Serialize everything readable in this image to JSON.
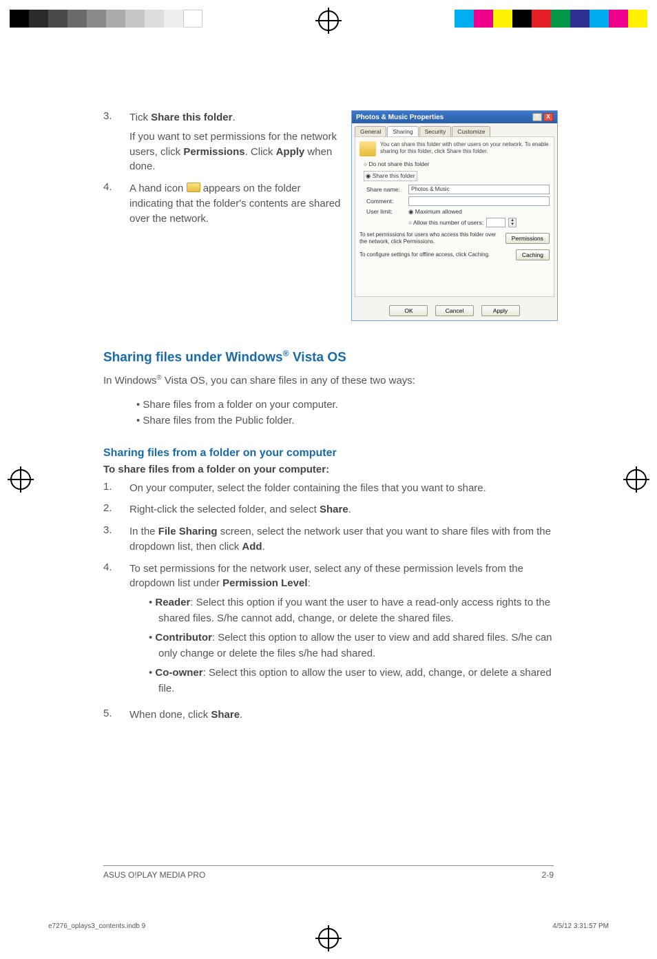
{
  "steps_top": {
    "s3": {
      "num": "3.",
      "line1_pre": "Tick ",
      "line1_bold": "Share this folder",
      "line1_post": ".",
      "line2_pre": "If you want to set permissions for the network users, click ",
      "line2_bold": "Permissions",
      "line2_mid": ". Click ",
      "line2_bold2": "Apply",
      "line2_post": " when done."
    },
    "s4": {
      "num": "4.",
      "pre": "A hand icon ",
      "post": " appears on the folder indicating that the folder's contents are shared over the network."
    }
  },
  "dialog": {
    "title": "Photos & Music Properties",
    "tabs": {
      "general": "General",
      "sharing": "Sharing",
      "security": "Security",
      "customize": "Customize"
    },
    "info": "You can share this folder with other users on your network.   To enable sharing for this folder, click Share this folder.",
    "opt_no_share": "Do not share this folder",
    "opt_share": "Share this folder",
    "share_name_label": "Share name:",
    "share_name_value": "Photos & Music",
    "comment_label": "Comment:",
    "userlimit_label": "User limit:",
    "opt_max": "Maximum allowed",
    "opt_allow": "Allow this number of users:",
    "perm_text": "To set permissions for users who access this folder over the network, click Permissions.",
    "perm_btn": "Permissions",
    "cache_text": "To configure settings for offline access, click Caching.",
    "cache_btn": "Caching",
    "ok": "OK",
    "cancel": "Cancel",
    "apply": "Apply",
    "help": "?",
    "close": "X"
  },
  "vista": {
    "heading_pre": "Sharing files under Windows",
    "heading_post": " Vista OS",
    "intro_pre": "In Windows",
    "intro_post": " Vista OS, you can share files in any of these two ways:",
    "bul1": "Share files from a folder on your computer.",
    "bul2": "Share files from the Public folder."
  },
  "folder": {
    "heading": "Sharing files from a folder on your computer",
    "lead": "To share files from a folder on your computer:",
    "s1": {
      "num": "1.",
      "text": "On your computer, select the folder containing the files that you want to share."
    },
    "s2": {
      "num": "2.",
      "pre": "Right-click the selected folder, and select ",
      "bold": "Share",
      "post": "."
    },
    "s3": {
      "num": "3.",
      "pre": "In the ",
      "bold1": "File Sharing",
      "mid": " screen, select the network user that you want to share files with from the dropdown list, then click ",
      "bold2": "Add",
      "post": "."
    },
    "s4": {
      "num": "4.",
      "pre": "To set permissions for the network user, select any of these permission levels from the dropdown list under ",
      "bold": "Permission Level",
      "post": ":",
      "reader_label": "Reader",
      "reader_text": ": Select this option if you want the user to have a read-only access rights to the shared files. S/he cannot add, change, or delete the shared files.",
      "contrib_label": "Contributor",
      "contrib_text": ": Select this option to allow the user to view and add shared files. S/he can only change or delete the files s/he had shared.",
      "coowner_label": "Co-owner",
      "coowner_text": ": Select this option to allow the user to view, add, change, or delete a shared file."
    },
    "s5": {
      "num": "5.",
      "pre": "When done, click ",
      "bold": "Share",
      "post": "."
    }
  },
  "footer": {
    "left": "ASUS O!PLAY MEDIA PRO",
    "right": "2-9"
  },
  "meta": {
    "left": "e7276_oplays3_contents.indb   9",
    "right": "4/5/12   3:31:57 PM"
  }
}
